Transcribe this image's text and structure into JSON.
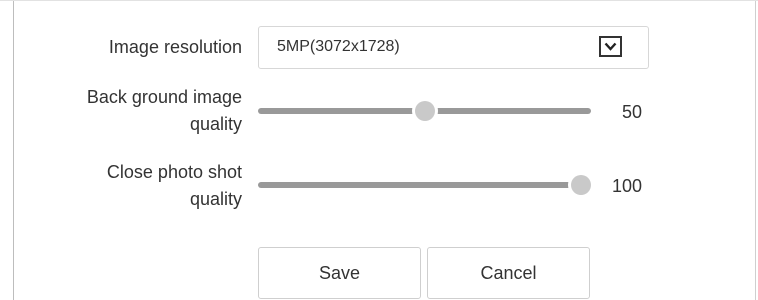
{
  "form": {
    "resolution": {
      "label": "Image resolution",
      "selected": "5MP(3072x1728)",
      "arrow_icon": "chevron-down-icon"
    },
    "background_quality": {
      "label_line1": "Back ground image",
      "label_line2": "quality",
      "value": 50,
      "value_text": "50",
      "min": 0,
      "max": 100
    },
    "closeup_quality": {
      "label_line1": "Close photo shot",
      "label_line2": "quality",
      "value": 100,
      "value_text": "100",
      "min": 0,
      "max": 100
    }
  },
  "buttons": {
    "save": "Save",
    "cancel": "Cancel"
  }
}
